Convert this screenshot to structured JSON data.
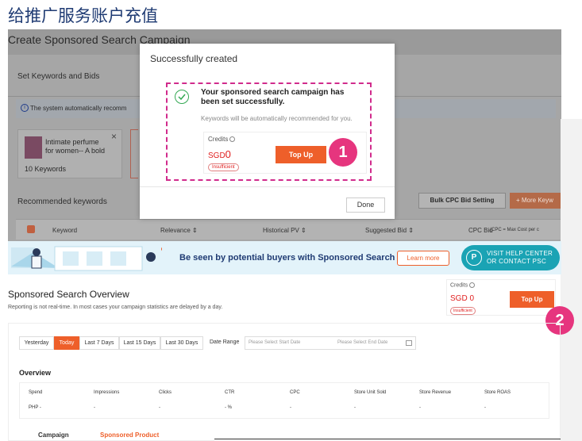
{
  "heading": "给推广服务账户充值",
  "campaign_screen": {
    "title": "Create Sponsored Search Campaign",
    "section": "Set Keywords and Bids",
    "notice": "The system automatically recomm",
    "product_name": "Intimate perfume for women-- A bold",
    "product_keywords": "10 Keywords",
    "recommended_label": "Recommended keywords",
    "bulk_button": "Bulk CPC Bid Setting",
    "more_button": "+ More Keyw",
    "columns": [
      "Keyword",
      "Relevance ⇕",
      "Historical PV ⇕",
      "Suggested Bid ⇕",
      "CPC Bid"
    ],
    "cpc_note": "(CPC = Max Cost per c"
  },
  "modal": {
    "title": "Successfully created",
    "message": "Your sponsored search campaign has been set successfully.",
    "submessage": "Keywords will be automatically recommended for you.",
    "credits_label": "Credits",
    "currency": "SGD",
    "amount": "0",
    "insufficient": "Insufficient",
    "topup": "Top Up",
    "done": "Done"
  },
  "badges": {
    "one": "1",
    "two": "2"
  },
  "banner": {
    "text": "Be seen by potential buyers with Sponsored Search",
    "learn_more": "Learn more",
    "visit_line1": "VISIT HELP CENTER",
    "visit_line2": "OR CONTACT PSC",
    "visit_icon": "P"
  },
  "overview": {
    "title": "Sponsored Search Overview",
    "note": "Reporting is not real-time. In most cases your campaign statistics are delayed by a day.",
    "credits_label": "Credits",
    "amount_text": "SGD 0",
    "insufficient": "Insufficient",
    "topup": "Top Up",
    "ranges": [
      "Yesterday",
      "Today",
      "Last 7 Days",
      "Last 15 Days",
      "Last 30 Days"
    ],
    "active_range": "Today",
    "date_range_label": "Date Range",
    "start_placeholder": "Please Select Start Date",
    "end_placeholder": "Please Select End Date",
    "overview_label": "Overview",
    "metrics": [
      {
        "name": "Spend",
        "value": "PHP -"
      },
      {
        "name": "Impressions",
        "value": "-"
      },
      {
        "name": "Clicks",
        "value": "-"
      },
      {
        "name": "CTR",
        "value": "- %"
      },
      {
        "name": "CPC",
        "value": "-"
      },
      {
        "name": "Store Unit Sold",
        "value": "-"
      },
      {
        "name": "Store Revenue",
        "value": "-"
      },
      {
        "name": "Store ROAS",
        "value": "-"
      }
    ],
    "bottom_tabs": [
      "Campaign",
      "Sponsored Product"
    ]
  },
  "colors": {
    "accent": "#ee5f2a",
    "badge": "#e6357e",
    "heading": "#1f3b73",
    "psc": "#1aa3b4"
  }
}
